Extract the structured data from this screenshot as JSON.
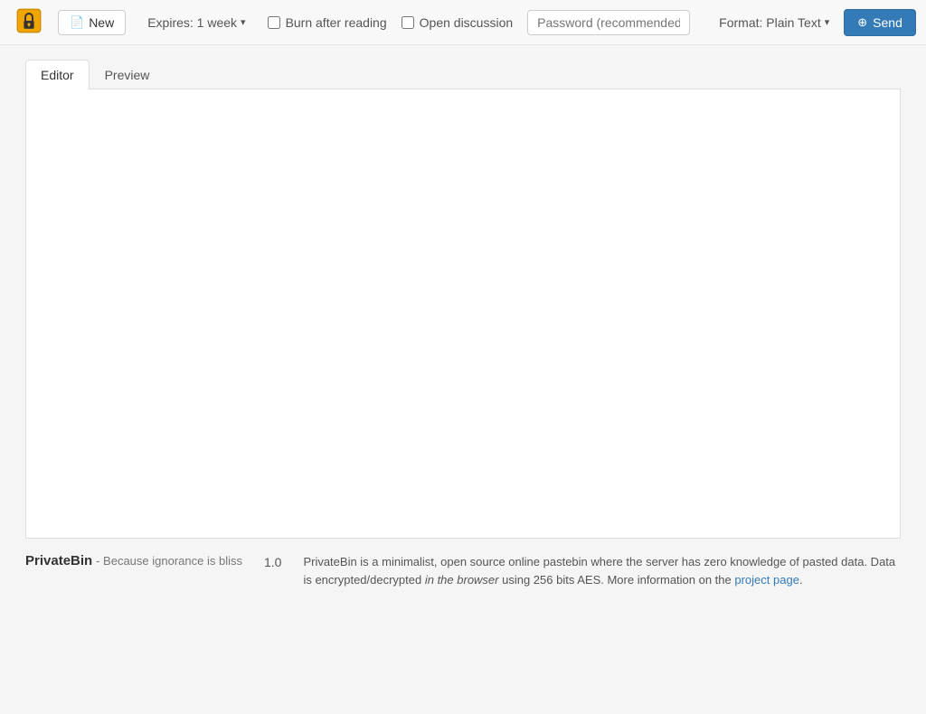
{
  "app": {
    "title": "PrivateBin",
    "tagline": "Because ignorance is bliss",
    "version": "1.0"
  },
  "navbar": {
    "new_button_label": "New",
    "expires_label": "Expires: 1 week",
    "burn_after_reading_label": "Burn after reading",
    "open_discussion_label": "Open discussion",
    "password_placeholder": "Password (recommended)",
    "format_label": "Format: Plain Text",
    "send_label": "Send"
  },
  "tabs": [
    {
      "id": "editor",
      "label": "Editor",
      "active": true
    },
    {
      "id": "preview",
      "label": "Preview",
      "active": false
    }
  ],
  "editor": {
    "placeholder": "",
    "content": ""
  },
  "footer": {
    "description_text": "PrivateBin is a minimalist, open source online pastebin where the server has zero knowledge of pasted data. Data is encrypted/decrypted ",
    "description_italic": "in the browser",
    "description_text2": " using 256 bits AES. More information on the ",
    "description_link": "project page",
    "description_end": "."
  }
}
